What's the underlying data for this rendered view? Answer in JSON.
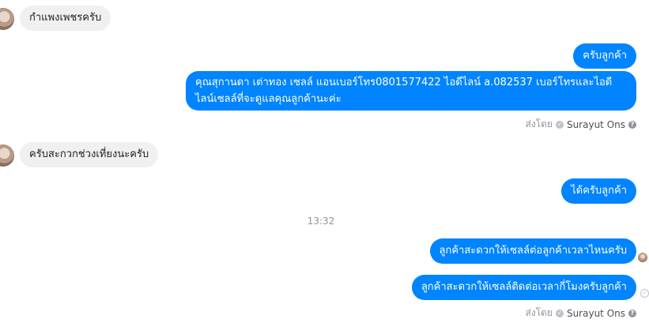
{
  "messages": [
    {
      "side": "in",
      "text": "กำแพงเพชรครับ"
    },
    {
      "side": "out",
      "text": "ครับลูกค้า"
    },
    {
      "side": "out",
      "text": "คุณสุกานดา เต่าทอง  เซลล์ แอนเบอร์โทร0801577422 ไอดีไลน์ a.082537  เบอร์โทรและไอดีไลน์เซลล์ที่จะดูแลคุณลูกค้านะค่ะ"
    },
    {
      "side": "in",
      "text": "ครับสะกวกช่วงเที่ยงนะครับ"
    },
    {
      "side": "out",
      "text": "ได้ครับลูกค้า"
    },
    {
      "side": "out",
      "text": "ลูกค้าสะดวกให้เซลล์ต่อลูกค้าเวลาไหนครับ"
    },
    {
      "side": "out",
      "text": "ลูกค้าสะดวกให้เซลล์ติดต่อเวลากี่โมงครับลูกค้า"
    }
  ],
  "sent_by": {
    "label": "ส่งโดย",
    "name": "Surayut Ons"
  },
  "timestamp": "13:32",
  "colors": {
    "outgoing_bubble": "#0084ff",
    "incoming_bubble": "#f1f0f0",
    "meta_text": "#4b4f56"
  },
  "icons": {
    "sent_check": "check-circle-icon",
    "help": "question-circle-icon"
  }
}
